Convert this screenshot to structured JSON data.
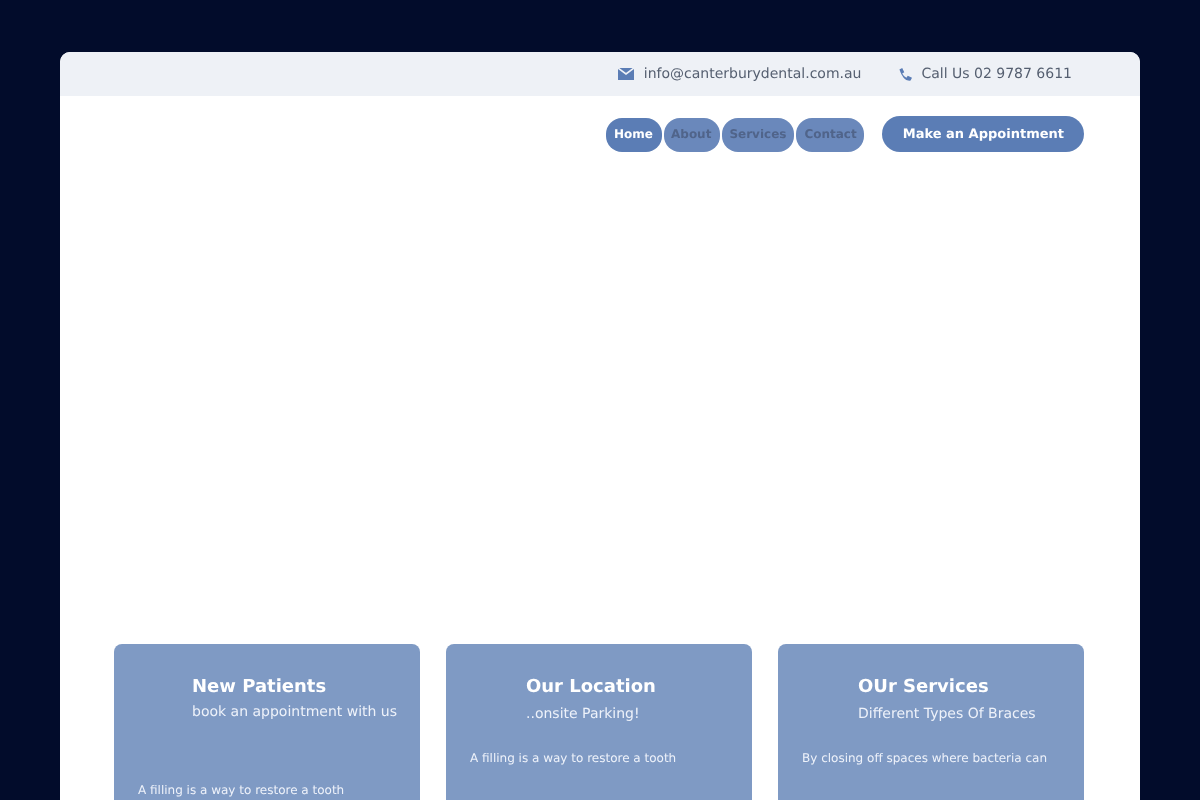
{
  "top_bar": {
    "email": "info@canterburydental.com.au",
    "phone": "Call Us 02 9787 6611"
  },
  "nav": [
    {
      "label": "Home",
      "selected": true
    },
    {
      "label": "About",
      "selected": false
    },
    {
      "label": "Services",
      "selected": false
    },
    {
      "label": "Contact",
      "selected": false
    }
  ],
  "appointment_button": "Make an Appointment",
  "cards": [
    {
      "title": "New Patients",
      "subtitle": "book an appointment with us",
      "body": "A filling is a way to restore a tooth"
    },
    {
      "title": "Our Location",
      "subtitle": "..onsite Parking!",
      "body": "A filling is a way to restore a tooth"
    },
    {
      "title": "OUr Services",
      "subtitle": "Different Types Of Braces",
      "body": "By closing off spaces where bacteria can"
    }
  ]
}
